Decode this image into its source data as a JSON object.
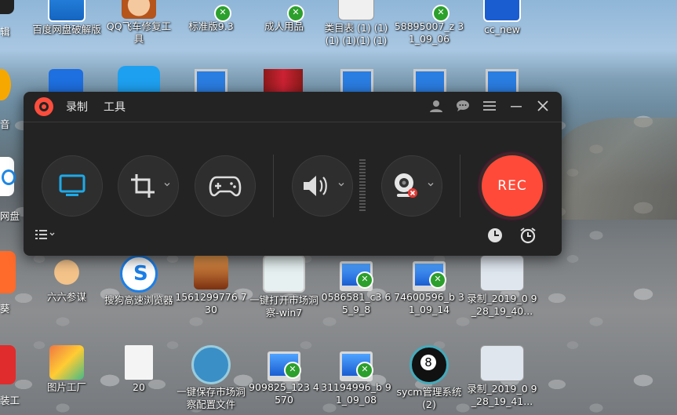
{
  "desktop": {
    "icons": [
      {
        "id": "baidu",
        "label": "百度网盘破解版"
      },
      {
        "id": "qqfeiche",
        "label": "QQ飞车修复工具"
      },
      {
        "id": "biaozhun",
        "label": "标准版9.3"
      },
      {
        "id": "chengren",
        "label": "成人用品"
      },
      {
        "id": "leimu",
        "label": "类目表 (1) (1) (1) (1)(1) (1)"
      },
      {
        "id": "f58895007",
        "label": "58895007_z 31_09_06"
      },
      {
        "id": "ccnew",
        "label": "cc_new"
      },
      {
        "id": "liuliu",
        "label": "六六参谋"
      },
      {
        "id": "sogou",
        "label": "搜狗高速浏览器"
      },
      {
        "id": "img1561",
        "label": "1561299776 730"
      },
      {
        "id": "yijian",
        "label": "一键打开市场洞察-win7"
      },
      {
        "id": "f0586581",
        "label": "0586581_c3 65_9_8"
      },
      {
        "id": "f74600596",
        "label": "74600596_b 31_09_14"
      },
      {
        "id": "luzhi1",
        "label": "录制_2019_0 9_28_19_40..."
      },
      {
        "id": "tupian",
        "label": "图片工厂"
      },
      {
        "id": "f20",
        "label": "20"
      },
      {
        "id": "yijianbaocun",
        "label": "一键保存市场洞察配置文件"
      },
      {
        "id": "f909825",
        "label": "909825_123 4570"
      },
      {
        "id": "f31194996",
        "label": "31194996_b 91_09_08"
      },
      {
        "id": "sycm",
        "label": "sycm管理系统 (2)"
      },
      {
        "id": "luzhi2",
        "label": "录制_2019_0 9_28_19_41..."
      }
    ],
    "edge_labels": {
      "l1": "辑",
      "l2": "音",
      "l3": "网盘",
      "l4": "葵",
      "l5": "装工"
    }
  },
  "recorder": {
    "menu": {
      "record": "录制",
      "tools": "工具"
    },
    "rec_label": "REC",
    "accent": "#ff4a3a",
    "screen_accent": "#1ea9e8"
  }
}
